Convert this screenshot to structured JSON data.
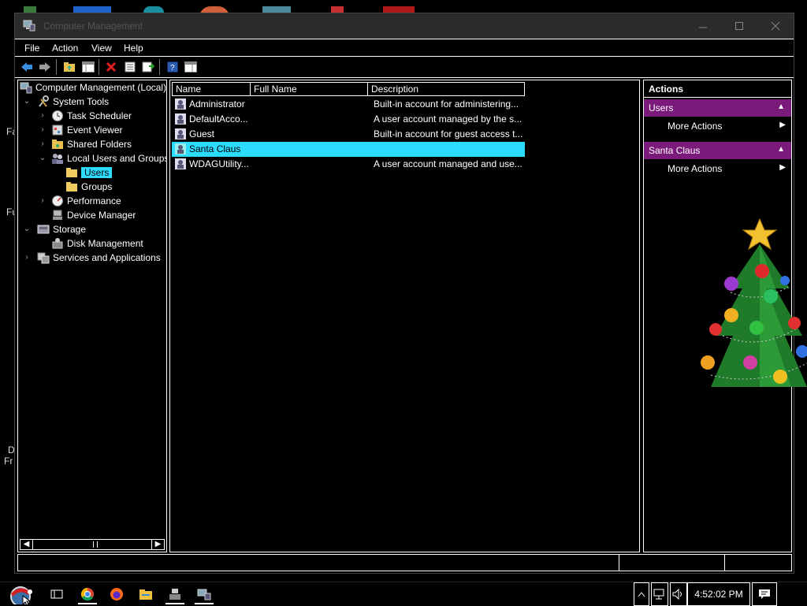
{
  "window": {
    "title": "Computer Management"
  },
  "menu": [
    "File",
    "Action",
    "View",
    "Help"
  ],
  "tree": {
    "root": "Computer Management (Local)",
    "system_tools": "System Tools",
    "task_scheduler": "Task Scheduler",
    "event_viewer": "Event Viewer",
    "shared_folders": "Shared Folders",
    "local_users_groups": "Local Users and Groups",
    "users": "Users",
    "groups": "Groups",
    "performance": "Performance",
    "device_manager": "Device Manager",
    "storage": "Storage",
    "disk_management": "Disk Management",
    "services_apps": "Services and Applications"
  },
  "list": {
    "columns": [
      "Name",
      "Full Name",
      "Description"
    ],
    "rows": [
      {
        "name": "Administrator",
        "full_name": "",
        "description": "Built-in account for administering..."
      },
      {
        "name": "DefaultAcco...",
        "full_name": "",
        "description": "A user account managed by the s..."
      },
      {
        "name": "Guest",
        "full_name": "",
        "description": "Built-in account for guest access t..."
      },
      {
        "name": "Santa Claus",
        "full_name": "",
        "description": ""
      },
      {
        "name": "WDAGUtility...",
        "full_name": "",
        "description": "A user account managed and use..."
      }
    ]
  },
  "actions": {
    "title": "Actions",
    "section1": "Users",
    "section1_item": "More Actions",
    "section2": "Santa Claus",
    "section2_item": "More Actions"
  },
  "taskbar": {
    "clock": "4:52:02 PM"
  },
  "desktop_fragments": [
    "Fa",
    "Fu",
    "D",
    "Fr"
  ],
  "colors": {
    "selection": "#2bdcff",
    "action_header": "#7a1a7a"
  }
}
